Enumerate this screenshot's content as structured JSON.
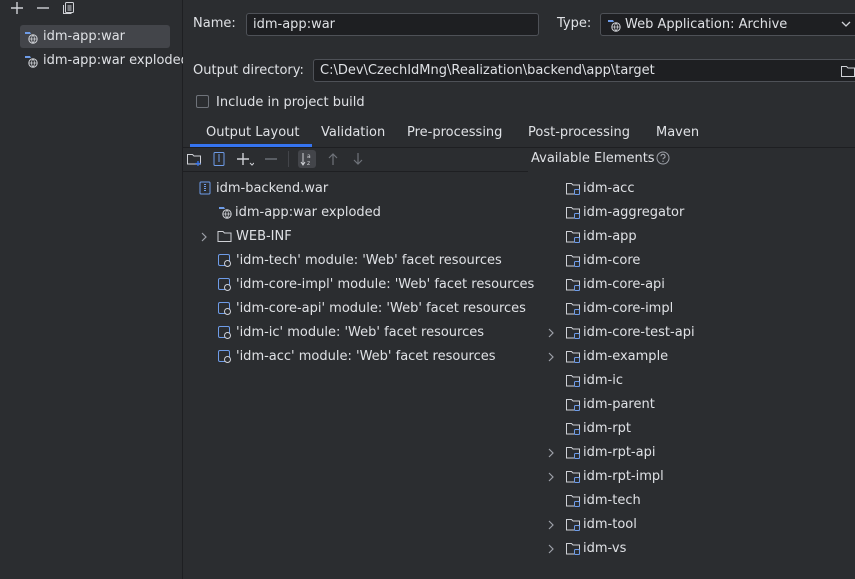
{
  "sidebar": {
    "toolbar": [
      "add-icon",
      "remove-icon",
      "copy-icon"
    ],
    "artifacts": [
      {
        "label": "idm-app:war",
        "selected": true
      },
      {
        "label": "idm-app:war exploded",
        "selected": false
      }
    ]
  },
  "form": {
    "name_label": "Name:",
    "name_value": "idm-app:war",
    "type_label": "Type:",
    "type_value": "Web Application: Archive",
    "output_label": "Output directory:",
    "output_value": "C:\\Dev\\CzechIdMng\\Realization\\backend\\app\\target",
    "include_label": "Include in project build",
    "include_checked": false
  },
  "tabs": [
    {
      "label": "Output Layout",
      "active": true
    },
    {
      "label": "Validation",
      "active": false
    },
    {
      "label": "Pre-processing",
      "active": false
    },
    {
      "label": "Post-processing",
      "active": false
    },
    {
      "label": "Maven",
      "active": false
    }
  ],
  "layout_tree": {
    "root": "idm-backend.war",
    "children": [
      "idm-app:war exploded",
      "WEB-INF",
      "'idm-tech' module: 'Web' facet resources",
      "'idm-core-impl' module: 'Web' facet resources",
      "'idm-core-api' module: 'Web' facet resources",
      "'idm-ic' module: 'Web' facet resources",
      "'idm-acc' module: 'Web' facet resources"
    ]
  },
  "available": {
    "title": "Available Elements",
    "items": [
      {
        "label": "idm-acc",
        "expandable": false
      },
      {
        "label": "idm-aggregator",
        "expandable": false
      },
      {
        "label": "idm-app",
        "expandable": false
      },
      {
        "label": "idm-core",
        "expandable": false
      },
      {
        "label": "idm-core-api",
        "expandable": false
      },
      {
        "label": "idm-core-impl",
        "expandable": false
      },
      {
        "label": "idm-core-test-api",
        "expandable": true
      },
      {
        "label": "idm-example",
        "expandable": true
      },
      {
        "label": "idm-ic",
        "expandable": false
      },
      {
        "label": "idm-parent",
        "expandable": false
      },
      {
        "label": "idm-rpt",
        "expandable": false
      },
      {
        "label": "idm-rpt-api",
        "expandable": true
      },
      {
        "label": "idm-rpt-impl",
        "expandable": true
      },
      {
        "label": "idm-tech",
        "expandable": false
      },
      {
        "label": "idm-tool",
        "expandable": true
      },
      {
        "label": "idm-vs",
        "expandable": true
      }
    ]
  },
  "colors": {
    "accent": "#3574f0",
    "background": "#2b2d30",
    "field": "#1e1f22",
    "selection": "#43454a"
  }
}
